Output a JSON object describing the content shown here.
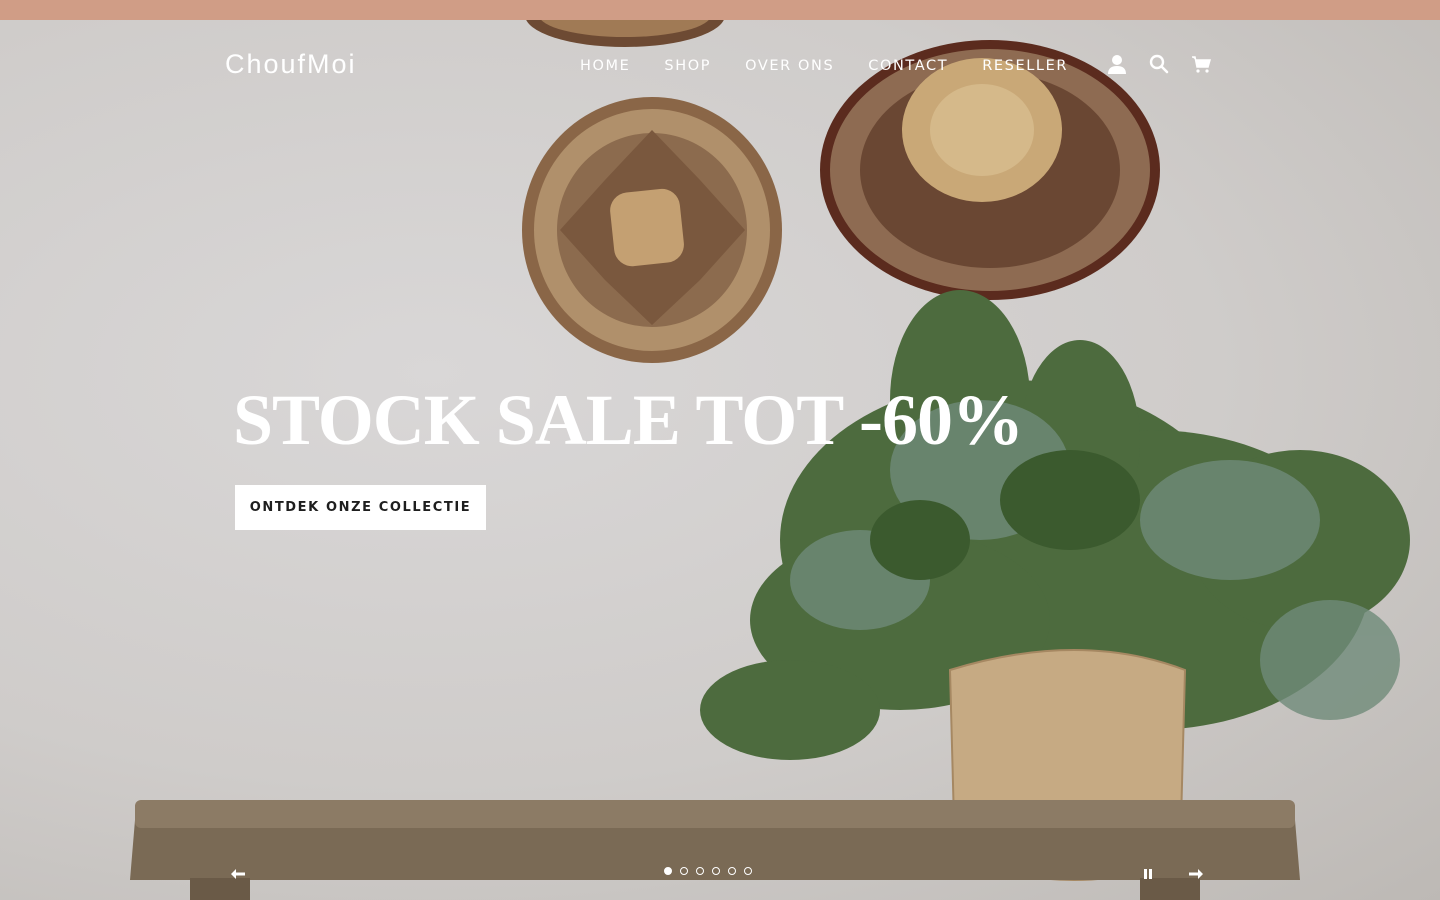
{
  "announcement": {
    "color": "#d09d86"
  },
  "header": {
    "logo": "ChoufMoi",
    "nav": [
      "HOME",
      "SHOP",
      "OVER ONS",
      "CONTACT",
      "RESELLER"
    ],
    "icons": [
      "account-icon",
      "search-icon",
      "cart-icon"
    ]
  },
  "hero": {
    "headline": "STOCK SALE TOT -60%",
    "cta_label": "ONTDEK ONZE COLLECTIE",
    "slides_count": 6,
    "active_slide": 1
  },
  "slideshow_controls": {
    "prev_icon": "arrow-left-icon",
    "pause_icon": "pause-icon",
    "next_icon": "arrow-right-icon"
  }
}
